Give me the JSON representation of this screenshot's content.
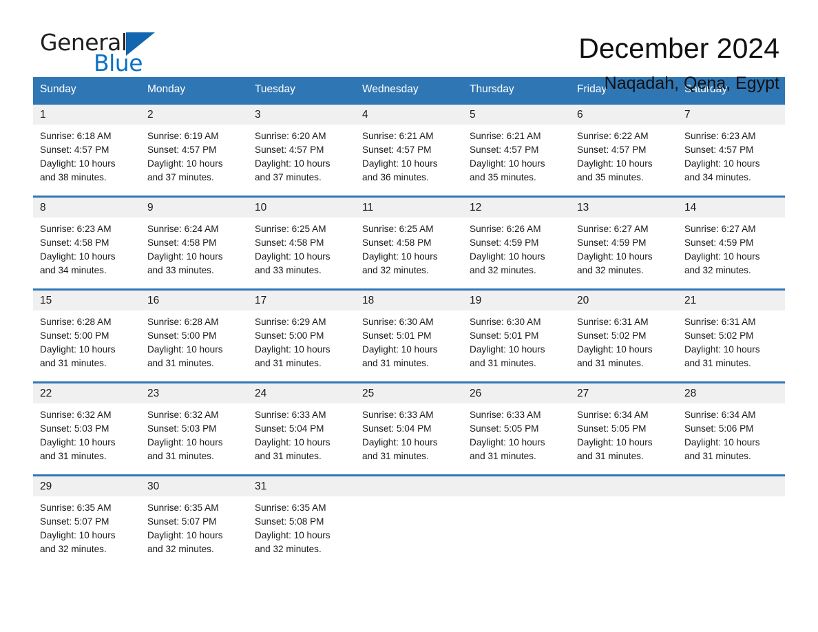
{
  "brand": {
    "name_part1": "General",
    "name_part2": "Blue",
    "logo_icon": "triangle-logo-icon",
    "colors": {
      "blue": "#0b72c4",
      "dark": "#231f20"
    }
  },
  "header": {
    "month_title": "December 2024",
    "location": "Naqadah, Qena, Egypt"
  },
  "theme": {
    "header_blue": "#2f76b4",
    "daynum_band": "#f0f0f0",
    "text": "#1a1a1a"
  },
  "calendar": {
    "weekday_headers": [
      "Sunday",
      "Monday",
      "Tuesday",
      "Wednesday",
      "Thursday",
      "Friday",
      "Saturday"
    ],
    "weeks": [
      [
        {
          "day": "1",
          "sunrise": "Sunrise: 6:18 AM",
          "sunset": "Sunset: 4:57 PM",
          "daylight_line1": "Daylight: 10 hours",
          "daylight_line2": "and 38 minutes."
        },
        {
          "day": "2",
          "sunrise": "Sunrise: 6:19 AM",
          "sunset": "Sunset: 4:57 PM",
          "daylight_line1": "Daylight: 10 hours",
          "daylight_line2": "and 37 minutes."
        },
        {
          "day": "3",
          "sunrise": "Sunrise: 6:20 AM",
          "sunset": "Sunset: 4:57 PM",
          "daylight_line1": "Daylight: 10 hours",
          "daylight_line2": "and 37 minutes."
        },
        {
          "day": "4",
          "sunrise": "Sunrise: 6:21 AM",
          "sunset": "Sunset: 4:57 PM",
          "daylight_line1": "Daylight: 10 hours",
          "daylight_line2": "and 36 minutes."
        },
        {
          "day": "5",
          "sunrise": "Sunrise: 6:21 AM",
          "sunset": "Sunset: 4:57 PM",
          "daylight_line1": "Daylight: 10 hours",
          "daylight_line2": "and 35 minutes."
        },
        {
          "day": "6",
          "sunrise": "Sunrise: 6:22 AM",
          "sunset": "Sunset: 4:57 PM",
          "daylight_line1": "Daylight: 10 hours",
          "daylight_line2": "and 35 minutes."
        },
        {
          "day": "7",
          "sunrise": "Sunrise: 6:23 AM",
          "sunset": "Sunset: 4:57 PM",
          "daylight_line1": "Daylight: 10 hours",
          "daylight_line2": "and 34 minutes."
        }
      ],
      [
        {
          "day": "8",
          "sunrise": "Sunrise: 6:23 AM",
          "sunset": "Sunset: 4:58 PM",
          "daylight_line1": "Daylight: 10 hours",
          "daylight_line2": "and 34 minutes."
        },
        {
          "day": "9",
          "sunrise": "Sunrise: 6:24 AM",
          "sunset": "Sunset: 4:58 PM",
          "daylight_line1": "Daylight: 10 hours",
          "daylight_line2": "and 33 minutes."
        },
        {
          "day": "10",
          "sunrise": "Sunrise: 6:25 AM",
          "sunset": "Sunset: 4:58 PM",
          "daylight_line1": "Daylight: 10 hours",
          "daylight_line2": "and 33 minutes."
        },
        {
          "day": "11",
          "sunrise": "Sunrise: 6:25 AM",
          "sunset": "Sunset: 4:58 PM",
          "daylight_line1": "Daylight: 10 hours",
          "daylight_line2": "and 32 minutes."
        },
        {
          "day": "12",
          "sunrise": "Sunrise: 6:26 AM",
          "sunset": "Sunset: 4:59 PM",
          "daylight_line1": "Daylight: 10 hours",
          "daylight_line2": "and 32 minutes."
        },
        {
          "day": "13",
          "sunrise": "Sunrise: 6:27 AM",
          "sunset": "Sunset: 4:59 PM",
          "daylight_line1": "Daylight: 10 hours",
          "daylight_line2": "and 32 minutes."
        },
        {
          "day": "14",
          "sunrise": "Sunrise: 6:27 AM",
          "sunset": "Sunset: 4:59 PM",
          "daylight_line1": "Daylight: 10 hours",
          "daylight_line2": "and 32 minutes."
        }
      ],
      [
        {
          "day": "15",
          "sunrise": "Sunrise: 6:28 AM",
          "sunset": "Sunset: 5:00 PM",
          "daylight_line1": "Daylight: 10 hours",
          "daylight_line2": "and 31 minutes."
        },
        {
          "day": "16",
          "sunrise": "Sunrise: 6:28 AM",
          "sunset": "Sunset: 5:00 PM",
          "daylight_line1": "Daylight: 10 hours",
          "daylight_line2": "and 31 minutes."
        },
        {
          "day": "17",
          "sunrise": "Sunrise: 6:29 AM",
          "sunset": "Sunset: 5:00 PM",
          "daylight_line1": "Daylight: 10 hours",
          "daylight_line2": "and 31 minutes."
        },
        {
          "day": "18",
          "sunrise": "Sunrise: 6:30 AM",
          "sunset": "Sunset: 5:01 PM",
          "daylight_line1": "Daylight: 10 hours",
          "daylight_line2": "and 31 minutes."
        },
        {
          "day": "19",
          "sunrise": "Sunrise: 6:30 AM",
          "sunset": "Sunset: 5:01 PM",
          "daylight_line1": "Daylight: 10 hours",
          "daylight_line2": "and 31 minutes."
        },
        {
          "day": "20",
          "sunrise": "Sunrise: 6:31 AM",
          "sunset": "Sunset: 5:02 PM",
          "daylight_line1": "Daylight: 10 hours",
          "daylight_line2": "and 31 minutes."
        },
        {
          "day": "21",
          "sunrise": "Sunrise: 6:31 AM",
          "sunset": "Sunset: 5:02 PM",
          "daylight_line1": "Daylight: 10 hours",
          "daylight_line2": "and 31 minutes."
        }
      ],
      [
        {
          "day": "22",
          "sunrise": "Sunrise: 6:32 AM",
          "sunset": "Sunset: 5:03 PM",
          "daylight_line1": "Daylight: 10 hours",
          "daylight_line2": "and 31 minutes."
        },
        {
          "day": "23",
          "sunrise": "Sunrise: 6:32 AM",
          "sunset": "Sunset: 5:03 PM",
          "daylight_line1": "Daylight: 10 hours",
          "daylight_line2": "and 31 minutes."
        },
        {
          "day": "24",
          "sunrise": "Sunrise: 6:33 AM",
          "sunset": "Sunset: 5:04 PM",
          "daylight_line1": "Daylight: 10 hours",
          "daylight_line2": "and 31 minutes."
        },
        {
          "day": "25",
          "sunrise": "Sunrise: 6:33 AM",
          "sunset": "Sunset: 5:04 PM",
          "daylight_line1": "Daylight: 10 hours",
          "daylight_line2": "and 31 minutes."
        },
        {
          "day": "26",
          "sunrise": "Sunrise: 6:33 AM",
          "sunset": "Sunset: 5:05 PM",
          "daylight_line1": "Daylight: 10 hours",
          "daylight_line2": "and 31 minutes."
        },
        {
          "day": "27",
          "sunrise": "Sunrise: 6:34 AM",
          "sunset": "Sunset: 5:05 PM",
          "daylight_line1": "Daylight: 10 hours",
          "daylight_line2": "and 31 minutes."
        },
        {
          "day": "28",
          "sunrise": "Sunrise: 6:34 AM",
          "sunset": "Sunset: 5:06 PM",
          "daylight_line1": "Daylight: 10 hours",
          "daylight_line2": "and 31 minutes."
        }
      ],
      [
        {
          "day": "29",
          "sunrise": "Sunrise: 6:35 AM",
          "sunset": "Sunset: 5:07 PM",
          "daylight_line1": "Daylight: 10 hours",
          "daylight_line2": "and 32 minutes."
        },
        {
          "day": "30",
          "sunrise": "Sunrise: 6:35 AM",
          "sunset": "Sunset: 5:07 PM",
          "daylight_line1": "Daylight: 10 hours",
          "daylight_line2": "and 32 minutes."
        },
        {
          "day": "31",
          "sunrise": "Sunrise: 6:35 AM",
          "sunset": "Sunset: 5:08 PM",
          "daylight_line1": "Daylight: 10 hours",
          "daylight_line2": "and 32 minutes."
        },
        {
          "day": "",
          "sunrise": "",
          "sunset": "",
          "daylight_line1": "",
          "daylight_line2": ""
        },
        {
          "day": "",
          "sunrise": "",
          "sunset": "",
          "daylight_line1": "",
          "daylight_line2": ""
        },
        {
          "day": "",
          "sunrise": "",
          "sunset": "",
          "daylight_line1": "",
          "daylight_line2": ""
        },
        {
          "day": "",
          "sunrise": "",
          "sunset": "",
          "daylight_line1": "",
          "daylight_line2": ""
        }
      ]
    ]
  }
}
